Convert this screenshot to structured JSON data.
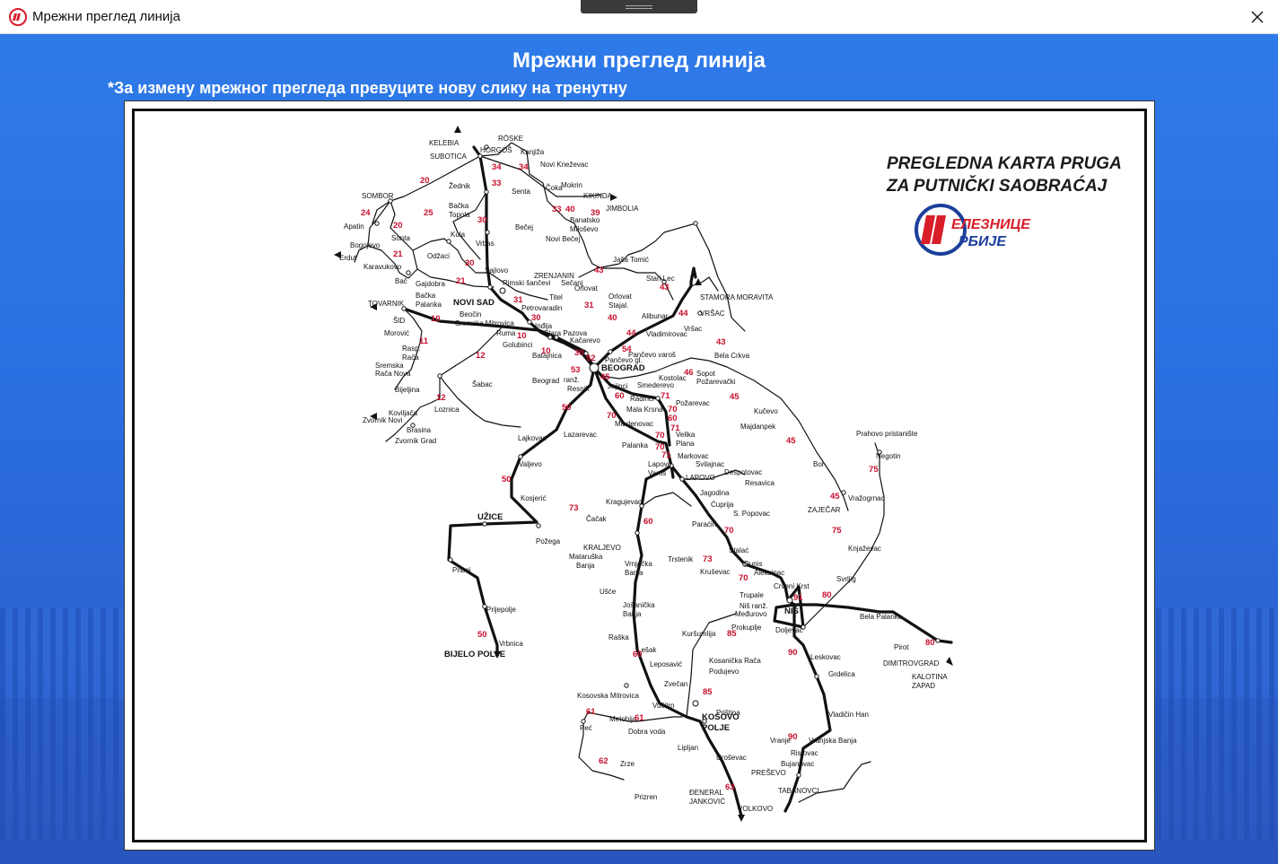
{
  "window": {
    "title": "Мрежни преглед линија",
    "icon": "zeleznice-srbije-logo-icon",
    "close_icon": "close-icon"
  },
  "page": {
    "heading": "Мрежни преглед линија",
    "hint": "*За измену мрежног прегледа превуците нову слику на тренутну"
  },
  "map": {
    "title_line1": "PREGLEDNA KARTA PRUGA",
    "title_line2": "ZA PUTNIČKI SAOBRAĆAJ",
    "logo_text": "ЖЕЛЕЗНИЦЕ СРБИЈЕ",
    "stations": [
      "KELEBIA",
      "RÖSKE",
      "HORGOŠ",
      "Kanjiža",
      "SUBOTICA",
      "Novi Kneževac",
      "SOMBOR",
      "Žednik",
      "Senta",
      "Čoka",
      "Mokrin",
      "KIKINDA",
      "JIMBOLIA",
      "Bačka Topola",
      "Banatsko Miloševo",
      "Apatin",
      "Kula",
      "Bečej",
      "Sonta",
      "Vrbas",
      "Novi Bečej",
      "Bogojevo",
      "Erdut",
      "Odžaci",
      "Karavukovo",
      "Jaša Tomić",
      "ZRENJANIN",
      "Sajlovo",
      "Bač",
      "Gajdobra",
      "Rimski šančevi",
      "Sečanj",
      "Stari Lec",
      "Bačka Palanka",
      "Orlovat",
      "Orlovat Stajal.",
      "Titel",
      "STAMORA MORAVITA",
      "TOVARNIK",
      "NOVI SAD",
      "Petrovaradin",
      "VRŠAC",
      "ŠID",
      "Beočin",
      "Alibunar",
      "Sremska Mitrovica",
      "Inđija",
      "Morović",
      "Ruma",
      "Stara Pazova",
      "Vladimirovac",
      "Golubinci",
      "Vršac",
      "Rasp. Rača",
      "Bela Crkva",
      "Kačarevo",
      "Sremska Rača Nova",
      "Batajnica",
      "Pančevo gl.",
      "Pančevo varoš",
      "Bijeljina",
      "BEOGRAD",
      "Sopot Požarevački",
      "Beograd ranž.",
      "Resnik",
      "Šabac",
      "Smederevo",
      "Kostolac",
      "Jajinci",
      "Radinci",
      "Požarevac",
      "Loznica",
      "Mala Krsna",
      "Kučevo",
      "Koviljača",
      "Majdanpek",
      "Zvornik Novi",
      "Brasina",
      "Zvornik Grad",
      "Mladenovac",
      "Velika Plana",
      "Prahovo pristanište",
      "Lajkovac",
      "Lazarevac",
      "Markovac",
      "Negotin",
      "Palanka",
      "Svilajnac",
      "Valjevo",
      "Lapovo Varoš",
      "LAPOVO",
      "Despotovac",
      "Bor",
      "Resavica",
      "Jagodina",
      "Kosjerić",
      "Kragujevac",
      "Ćuprija",
      "ZAJEČAR",
      "Vražogrnac",
      "S. Popovac",
      "Čačak",
      "UŽICE",
      "Požega",
      "Paraćin",
      "KRALJEVO",
      "Knjaževac",
      "Mataruška Banja",
      "Stalać",
      "Trstenik",
      "Vrnjačka Banja",
      "Kruševac",
      "Đunis",
      "Priboj",
      "Aleksinac",
      "Svrljig",
      "Crveni Krst",
      "Ušće",
      "Trupale",
      "Niš ranž.",
      "Josanička Banja",
      "Prijepolje",
      "Međurovo",
      "NIŠ",
      "Bela Palanka",
      "Prokuplje",
      "Doljevac",
      "Kuršumlija",
      "Raška",
      "Pirot",
      "Vrbnica",
      "BIJELO POLJE",
      "Lešak",
      "Kosanička Rača",
      "Leskovac",
      "DIMITROVGRAD",
      "Leposavić",
      "Podujevo",
      "KALOTINA ZAPAD",
      "Grdelica",
      "Zvečan",
      "Kosovska Mitrovica",
      "Vučitrn",
      "Vladičin Han",
      "Metohija",
      "Priština",
      "Peć",
      "Dobra voda",
      "KOSOVO POLJE",
      "Vranje",
      "Vranjska Banja",
      "Ristovac",
      "Lipljan",
      "Bujanovac",
      "Uroševac",
      "Zrze",
      "PREŠEVO",
      "TABANOVCI",
      "Prizren",
      "ĐENERAL JANKOVIĆ",
      "VOLKOVO"
    ],
    "line_numbers": [
      "20",
      "34",
      "33",
      "24",
      "25",
      "30",
      "40",
      "39",
      "20",
      "21",
      "21",
      "43",
      "31",
      "10",
      "40",
      "44",
      "43",
      "11",
      "10",
      "12",
      "54",
      "52",
      "30",
      "53",
      "45",
      "46",
      "60",
      "12",
      "71",
      "70",
      "50",
      "71",
      "70",
      "60",
      "45",
      "75",
      "70",
      "50",
      "45",
      "73",
      "60",
      "73",
      "70",
      "75",
      "91",
      "80",
      "85",
      "60",
      "90",
      "80",
      "85",
      "50",
      "61",
      "62",
      "90",
      "61",
      "63"
    ]
  }
}
